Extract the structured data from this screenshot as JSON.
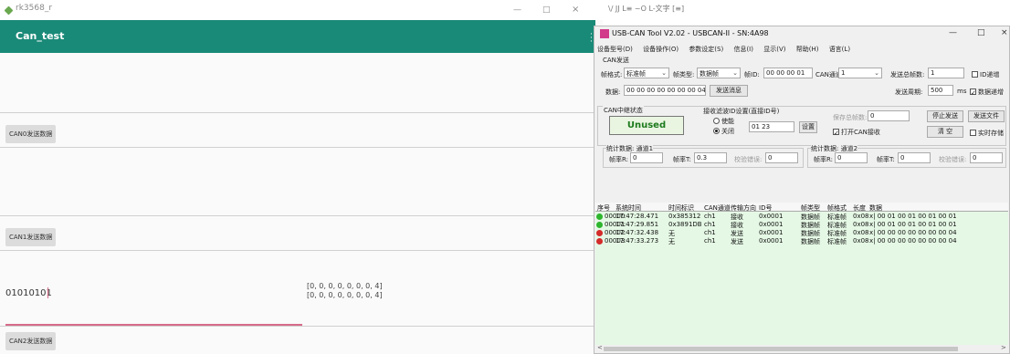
{
  "android": {
    "status_title": "rk3568_r",
    "app_title": "Can_test",
    "can0_button": "CAN0发送数据",
    "can1_button": "CAN1发送数据",
    "can2_button": "CAN2发送数据",
    "input_value": "01010101",
    "received_lines": [
      "[0, 0, 0, 0, 0, 0, 0, 4]",
      "[0, 0, 0, 0, 0, 0, 0, 4]"
    ],
    "window_min": "—",
    "window_max": "□",
    "window_close": "×"
  },
  "topstrip": {
    "text": "\\/  JJ  L≡  ~O  L-文字  [≡]"
  },
  "tool": {
    "title": "USB-CAN Tool V2.02 - USBCAN-II - SN:4A98",
    "win_min": "—",
    "win_max": "□",
    "win_close": "×",
    "menu": [
      "设备型号(D)",
      "设备操作(O)",
      "参数设定(S)",
      "信息(I)",
      "显示(V)",
      "帮助(H)",
      "语言(L)"
    ],
    "can_send_label": "CAN发送",
    "frame_format_label": "帧格式:",
    "frame_format_value": "标准帧",
    "frame_type_label": "帧类型:",
    "frame_type_value": "数据帧",
    "frame_id_label": "帧ID:",
    "frame_id_value": "00 00 00 01",
    "can_channel_label": "CAN通道:",
    "can_channel_value": "1",
    "send_total_label": "发送总帧数:",
    "send_total_value": "1",
    "id_increment_label": "ID递增",
    "data_label": "数据:",
    "data_value": "00 00 00 00 00 00 00 04",
    "send_msg_button": "发送消息",
    "send_period_label": "发送周期:",
    "send_period_value": "500",
    "send_period_unit": "ms",
    "data_increment_label": "数据递增",
    "relay_status_label": "CAN中继状态",
    "relay_status_value": "Unused",
    "filter_label": "接收滤波ID设置(直接ID号)",
    "enable_label": "使能",
    "close_label": "关闭",
    "filter_value": "01 23",
    "set_button": "设置",
    "save_count_label": "保存总帧数:",
    "save_count_value": "0",
    "stop_send_button": "停止发送",
    "send_file_button": "发送文件",
    "open_can_recv_label": "打开CAN接收",
    "clear_button": "清 空",
    "realtime_save_label": "实时存储",
    "stats_ch1_label": "统计数据: 通道1",
    "stats_ch2_label": "统计数据: 通道2",
    "fr_label": "帧率R:",
    "ft_label": "帧率T:",
    "checksum_err_label": "校验错误:",
    "ch1_fr": "0",
    "ch1_ft": "0.3",
    "ch1_err": "0",
    "ch2_fr": "0",
    "ch2_ft": "0",
    "ch2_err": "0",
    "log_columns": [
      "序号",
      "系统时间",
      "时间标识",
      "CAN通道",
      "传输方向",
      "ID号",
      "帧类型",
      "帧格式",
      "长度",
      "数据"
    ],
    "log_rows": [
      {
        "status": "green",
        "seq": "00000",
        "sys_time": "17:47:28.471",
        "time_id": "0x385312",
        "channel": "ch1",
        "direction": "接收",
        "id": "0x0001",
        "frame_type": "数据帧",
        "frame_format": "标准帧",
        "length": "0x08",
        "data": "x| 00 01 00 01 00 01 00 01"
      },
      {
        "status": "green",
        "seq": "00001",
        "sys_time": "17:47:29.851",
        "time_id": "0x3891DB",
        "channel": "ch1",
        "direction": "接收",
        "id": "0x0001",
        "frame_type": "数据帧",
        "frame_format": "标准帧",
        "length": "0x08",
        "data": "x| 00 01 00 01 00 01 00 01"
      },
      {
        "status": "red",
        "seq": "00002",
        "sys_time": "17:47:32.438",
        "time_id": "无",
        "channel": "ch1",
        "direction": "发送",
        "id": "0x0001",
        "frame_type": "数据帧",
        "frame_format": "标准帧",
        "length": "0x08",
        "data": "x| 00 00 00 00 00 00 00 04"
      },
      {
        "status": "red",
        "seq": "00003",
        "sys_time": "17:47:33.273",
        "time_id": "无",
        "channel": "ch1",
        "direction": "发送",
        "id": "0x0001",
        "frame_type": "数据帧",
        "frame_format": "标准帧",
        "length": "0x08",
        "data": "x| 00 00 00 00 00 00 00 04"
      }
    ],
    "scroll_left": "<",
    "scroll_right": ">"
  },
  "colors": {
    "appbar": "#1a8a78",
    "status_green": "#2db52d",
    "status_red": "#d42a2a",
    "log_background": "#e5f8e5"
  }
}
